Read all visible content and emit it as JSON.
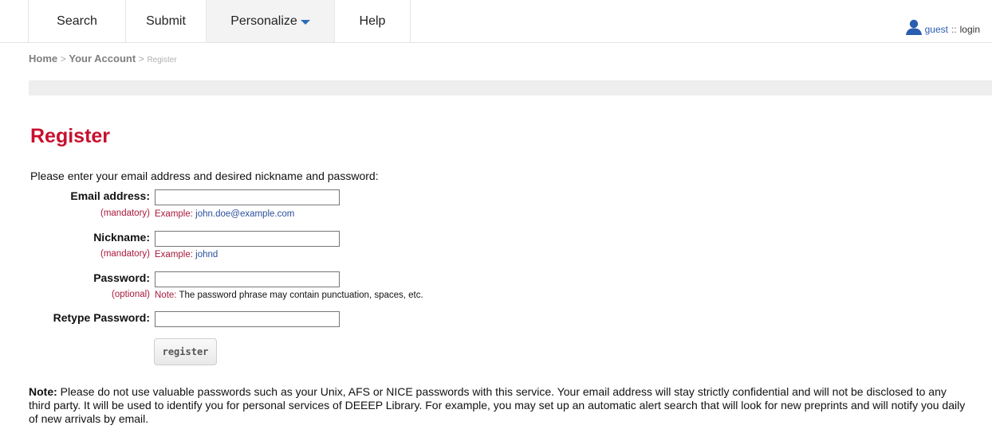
{
  "nav": {
    "items": [
      {
        "label": "Search"
      },
      {
        "label": "Submit"
      },
      {
        "label": "Personalize"
      },
      {
        "label": "Help"
      }
    ]
  },
  "user": {
    "guest": "guest",
    "separator": "::",
    "login": "login",
    "icon": "user-icon"
  },
  "breadcrumb": {
    "home": "Home",
    "sep": ">",
    "account": "Your Account",
    "current": "Register"
  },
  "page": {
    "title": "Register",
    "intro": "Please enter your email address and desired nickname and password:"
  },
  "form": {
    "email": {
      "label": "Email address:",
      "value": "",
      "tag": "(mandatory)",
      "hint_label": "Example:",
      "hint_value": "john.doe@example.com"
    },
    "nickname": {
      "label": "Nickname:",
      "value": "",
      "tag": "(mandatory)",
      "hint_label": "Example:",
      "hint_value": "johnd"
    },
    "password": {
      "label": "Password:",
      "value": "",
      "tag": "(optional)",
      "hint_label": "Note:",
      "hint_value": "The password phrase may contain punctuation, spaces, etc."
    },
    "retype": {
      "label": "Retype Password:",
      "value": ""
    },
    "submit_label": "register"
  },
  "note": {
    "label": "Note:",
    "text": "Please do not use valuable passwords such as your Unix, AFS or NICE passwords with this service. Your email address will stay strictly confidential and will not be disclosed to any third party. It will be used to identify you for personal services of DEEEP Library. For example, you may set up an automatic alert search that will look for new preprints and will notify you daily of new arrivals by email."
  },
  "colors": {
    "title": "#c8102e",
    "hint_tag": "#a8193a",
    "link": "#2a5db0"
  }
}
